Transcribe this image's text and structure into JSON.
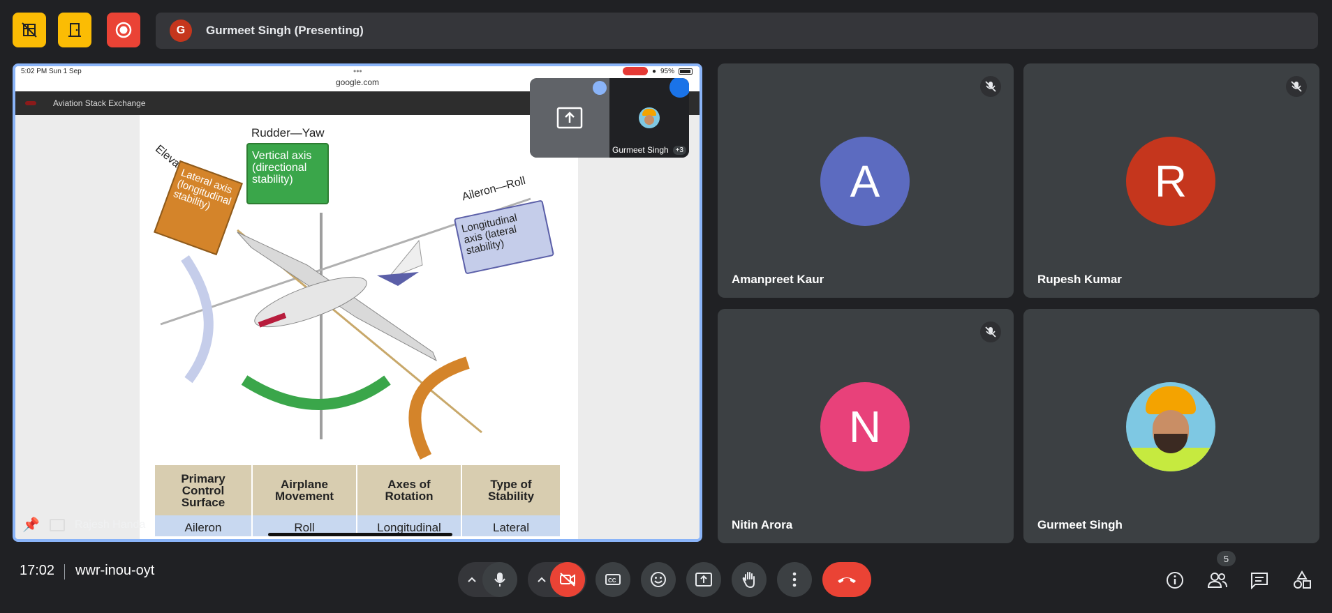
{
  "top": {
    "presenter_initial": "G",
    "presenting_label": "Gurmeet Singh (Presenting)"
  },
  "shared_screen": {
    "ios_time": "5:02 PM   Sun 1 Sep",
    "ios_dots": "•••",
    "ios_url": "google.com",
    "ios_battery": "95%",
    "site_name": "Aviation Stack Exchange",
    "pip_name": "Gurmeet Singh",
    "pip_extra": "+3",
    "presenter_caption": "Rajesh Handa",
    "diagram": {
      "rudder": "Rudder—Yaw",
      "vertical_box": [
        "Vertical axis",
        "(directional",
        "stability)"
      ],
      "elevator": "Elevator—Pitch",
      "lateral_box": [
        "Lateral axis",
        "(longitudinal",
        "stability)"
      ],
      "aileron": "Aileron—Roll",
      "longitudinal_box": [
        "Longitudinal",
        "axis (lateral",
        "stability)"
      ],
      "table_headers": [
        [
          "Primary",
          "Control",
          "Surface"
        ],
        [
          "Airplane",
          "Movement"
        ],
        [
          "Axes of",
          "Rotation"
        ],
        [
          "Type of",
          "Stability"
        ]
      ],
      "table_row": [
        "Aileron",
        "Roll",
        "Longitudinal",
        "Lateral"
      ]
    }
  },
  "participants": [
    {
      "initial": "A",
      "name": "Amanpreet Kaur",
      "color": "#5c6bc0",
      "muted": true
    },
    {
      "initial": "R",
      "name": "Rupesh Kumar",
      "color": "#c5361d",
      "muted": true
    },
    {
      "initial": "N",
      "name": "Nitin Arora",
      "color": "#e8417a",
      "muted": true
    },
    {
      "initial": "",
      "name": "Gurmeet Singh",
      "color": "#7ec8e3",
      "muted": false
    }
  ],
  "bottom": {
    "time": "17:02",
    "meeting_code": "wwr-inou-oyt",
    "people_count": "5"
  },
  "colors": {
    "accent_yellow": "#fbbc04",
    "record_red": "#ea4335",
    "hangup_red": "#ea4335",
    "presenting_border": "#8ab4f8"
  }
}
